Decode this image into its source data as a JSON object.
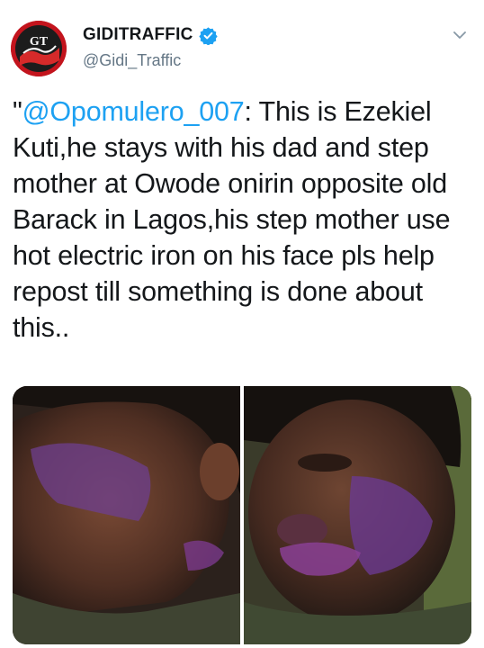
{
  "account": {
    "display_name": "GIDITRAFFIC",
    "handle": "@Gidi_Traffic",
    "verified": true,
    "avatar_initials": "GT"
  },
  "tweet": {
    "prefix": "\"",
    "mention": "@Opomulero_007",
    "body": ": This is Ezekiel Kuti,he stays with his dad and step mother at Owode onirin opposite old Barack in Lagos,his step mother use hot electric iron on his face pls help repost till something is done about this.."
  },
  "icons": {
    "verified": "verified-badge-icon",
    "menu": "chevron-down-icon"
  },
  "colors": {
    "link": "#1da1f2",
    "verified": "#1da1f2",
    "handle": "#657786"
  }
}
